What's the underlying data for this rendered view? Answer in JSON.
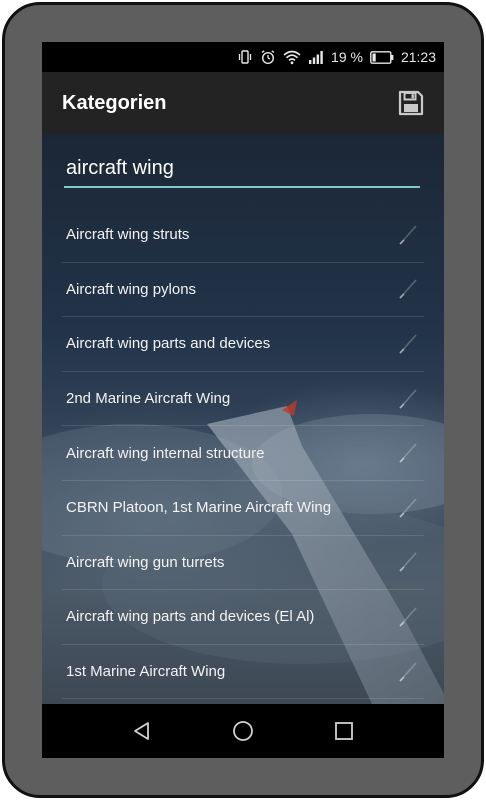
{
  "status_bar": {
    "battery_text": "19 %",
    "time": "21:23",
    "icons": [
      "vibrate-icon",
      "alarm-icon",
      "wifi-icon",
      "signal-icon",
      "battery-icon"
    ]
  },
  "app_bar": {
    "title": "Kategorien",
    "save_icon": "save-icon"
  },
  "search": {
    "value": "aircraft wing",
    "underline_color": "#80cbc4"
  },
  "results": [
    {
      "label": "Aircraft wing struts"
    },
    {
      "label": "Aircraft wing pylons"
    },
    {
      "label": "Aircraft wing parts and devices"
    },
    {
      "label": "2nd Marine Aircraft Wing"
    },
    {
      "label": "Aircraft wing internal structure"
    },
    {
      "label": "CBRN Platoon, 1st Marine Aircraft Wing"
    },
    {
      "label": "Aircraft wing gun turrets"
    },
    {
      "label": "Aircraft wing parts and devices (El Al)"
    },
    {
      "label": "1st Marine Aircraft Wing"
    }
  ],
  "nav_bar": {
    "icons": [
      "back-icon",
      "home-icon",
      "recents-icon"
    ]
  }
}
